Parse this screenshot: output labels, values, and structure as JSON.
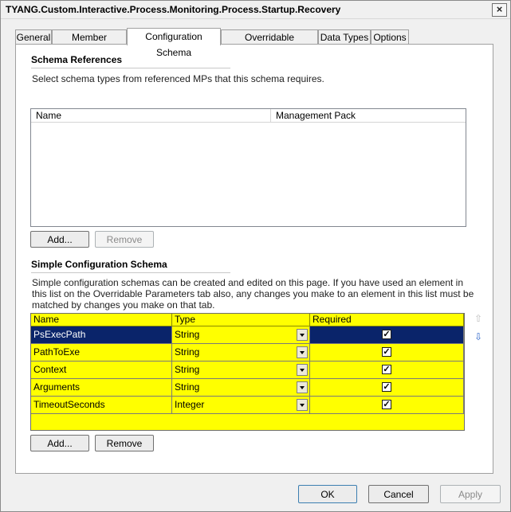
{
  "window": {
    "title": "TYANG.Custom.Interactive.Process.Monitoring.Process.Startup.Recovery",
    "close_glyph": "×"
  },
  "tabs": [
    {
      "label": "General",
      "active": false
    },
    {
      "label": "Member Modules",
      "active": false
    },
    {
      "label": "Configuration Schema",
      "active": true
    },
    {
      "label": "Overridable Parameters",
      "active": false
    },
    {
      "label": "Data Types",
      "active": false
    },
    {
      "label": "Options",
      "active": false
    }
  ],
  "schema_references": {
    "title": "Schema References",
    "description": "Select schema types from referenced MPs that this schema requires.",
    "columns": [
      "Name",
      "Management Pack"
    ],
    "add_label": "Add...",
    "remove_label": "Remove"
  },
  "simple_schema": {
    "title": "Simple Configuration Schema",
    "description": "Simple configuration schemas can be created and edited on this page.  If you have used an element in this list on the Overridable Parameters tab also, any changes you make to an element in this list must be matched by changes you make on that tab.",
    "columns": [
      "Name",
      "Type",
      "Required"
    ],
    "rows": [
      {
        "name": "PsExecPath",
        "type": "String",
        "required": "✓"
      },
      {
        "name": "PathToExe",
        "type": "String",
        "required": "✓"
      },
      {
        "name": "Context",
        "type": "String",
        "required": "✓"
      },
      {
        "name": "Arguments",
        "type": "String",
        "required": "✓"
      },
      {
        "name": "TimeoutSeconds",
        "type": "Integer",
        "required": "✓"
      }
    ],
    "add_label": "Add...",
    "remove_label": "Remove",
    "move_up_glyph": "⇧",
    "move_down_glyph": "⇩"
  },
  "footer": {
    "ok_label": "OK",
    "cancel_label": "Cancel",
    "apply_label": "Apply"
  },
  "colors": {
    "grid_bg": "#ffff00",
    "selected_row": "#0a246a"
  }
}
